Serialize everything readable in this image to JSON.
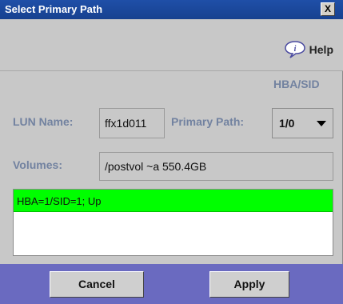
{
  "window": {
    "title": "Select Primary Path",
    "close_glyph": "X"
  },
  "help": {
    "label": "Help",
    "icon": "info-speech-bubble-icon"
  },
  "column_header": "HBA/SID",
  "lun": {
    "label": "LUN Name:",
    "value": "ffx1d011"
  },
  "primary_path": {
    "label": "Primary Path:",
    "selected": "1/0"
  },
  "volumes": {
    "label": "Volumes:",
    "value": "/postvol ~a 550.4GB"
  },
  "paths_list": {
    "items": [
      "HBA=1/SID=1; Up"
    ],
    "selected_color": "#00ff00"
  },
  "buttons": {
    "cancel": "Cancel",
    "apply": "Apply"
  },
  "colors": {
    "titlebar": "#1f4fa8",
    "label": "#7282a0",
    "footer": "#6a6ac0",
    "panel": "#c8c8c8"
  }
}
